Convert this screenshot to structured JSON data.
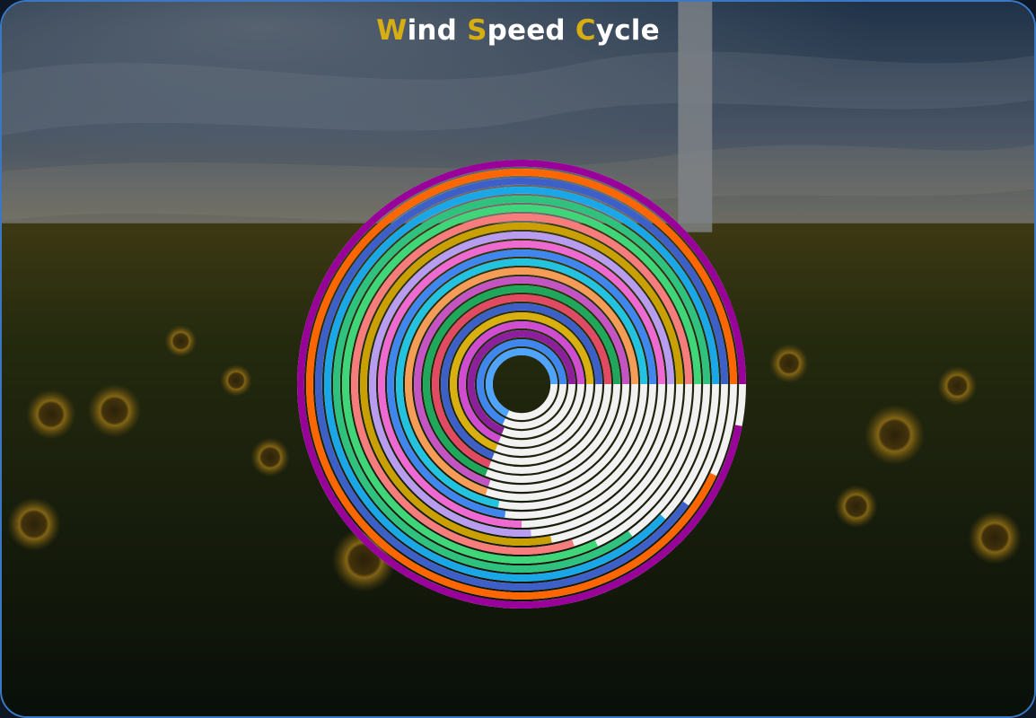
{
  "title": {
    "words": [
      {
        "cap": "W",
        "rest": "ind"
      },
      {
        "cap": "S",
        "rest": "peed"
      },
      {
        "cap": "C",
        "rest": "ycle"
      }
    ]
  },
  "colors": {
    "accent": "#d7ae12",
    "title_text": "#ffffff",
    "frame_border": "#3b78c4",
    "ring_background": "#f2f2f2"
  },
  "chart_data": {
    "type": "radial-bar",
    "title": "Wind Speed Cycle",
    "value_max": 100,
    "legend": "none",
    "grid": false,
    "series": [
      {
        "value": 97,
        "color": "#990099"
      },
      {
        "value": 93,
        "color": "#ff6600"
      },
      {
        "value": 90,
        "color": "#3d5fc8"
      },
      {
        "value": 88,
        "color": "#1aa7e8"
      },
      {
        "value": 85,
        "color": "#2ec27e"
      },
      {
        "value": 82,
        "color": "#3fd67a"
      },
      {
        "value": 80,
        "color": "#f77c7c"
      },
      {
        "value": 78,
        "color": "#c9a000"
      },
      {
        "value": 76,
        "color": "#b89cf0"
      },
      {
        "value": 75,
        "color": "#ee6ad2"
      },
      {
        "value": 73,
        "color": "#3f86ef"
      },
      {
        "value": 72,
        "color": "#22c3e0"
      },
      {
        "value": 70,
        "color": "#f59d57"
      },
      {
        "value": 70,
        "color": "#c454c4"
      },
      {
        "value": 69,
        "color": "#1fa85c"
      },
      {
        "value": 69,
        "color": "#e24a63"
      },
      {
        "value": 69,
        "color": "#3d5fc8"
      },
      {
        "value": 69,
        "color": "#dab010"
      },
      {
        "value": 69,
        "color": "#d04cd0"
      },
      {
        "value": 69,
        "color": "#8b1f9c"
      },
      {
        "value": 68,
        "color": "#3f86ef"
      },
      {
        "value": 68,
        "color": "#4fa4ff"
      }
    ]
  }
}
